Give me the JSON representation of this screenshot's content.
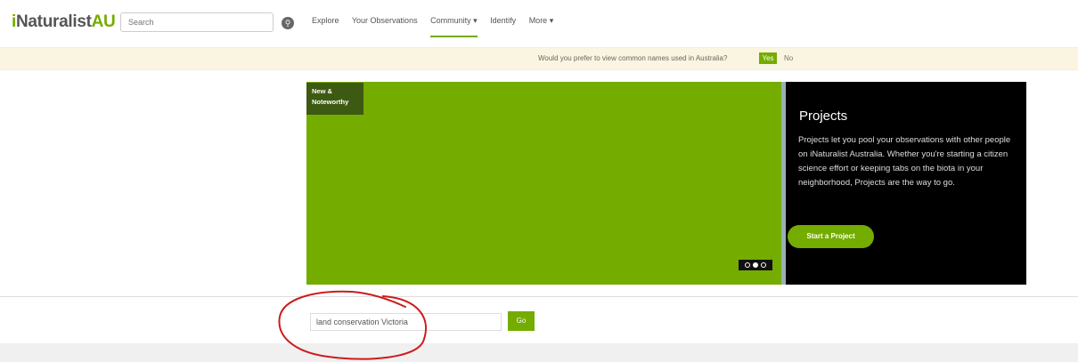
{
  "header": {
    "logo": {
      "prefix": "i",
      "name": "Naturalist",
      "suffix": "AU"
    },
    "search": {
      "placeholder": "Search"
    },
    "nav": {
      "explore": "Explore",
      "your_observations": "Your Observations",
      "community": "Community ▾",
      "identify": "Identify",
      "more": "More ▾"
    }
  },
  "notice": {
    "text": "Would you prefer to view common names used in Australia?",
    "yes": "Yes",
    "no": "No"
  },
  "hero": {
    "label": "New & Noteworthy",
    "panel_title": "Projects",
    "panel_text": "Projects let you pool your observations with other people on iNaturalist Australia. Whether you're starting a citizen science effort or keeping tabs on the biota in your neighborhood, Projects are the way to go.",
    "button": "Start a Project",
    "carousel_active_index": 1
  },
  "footer": {
    "input_value": "land conservation Victoria",
    "go": "Go"
  },
  "colors": {
    "brand_green": "#74ac00",
    "annotation_red": "#cc1b1b"
  }
}
